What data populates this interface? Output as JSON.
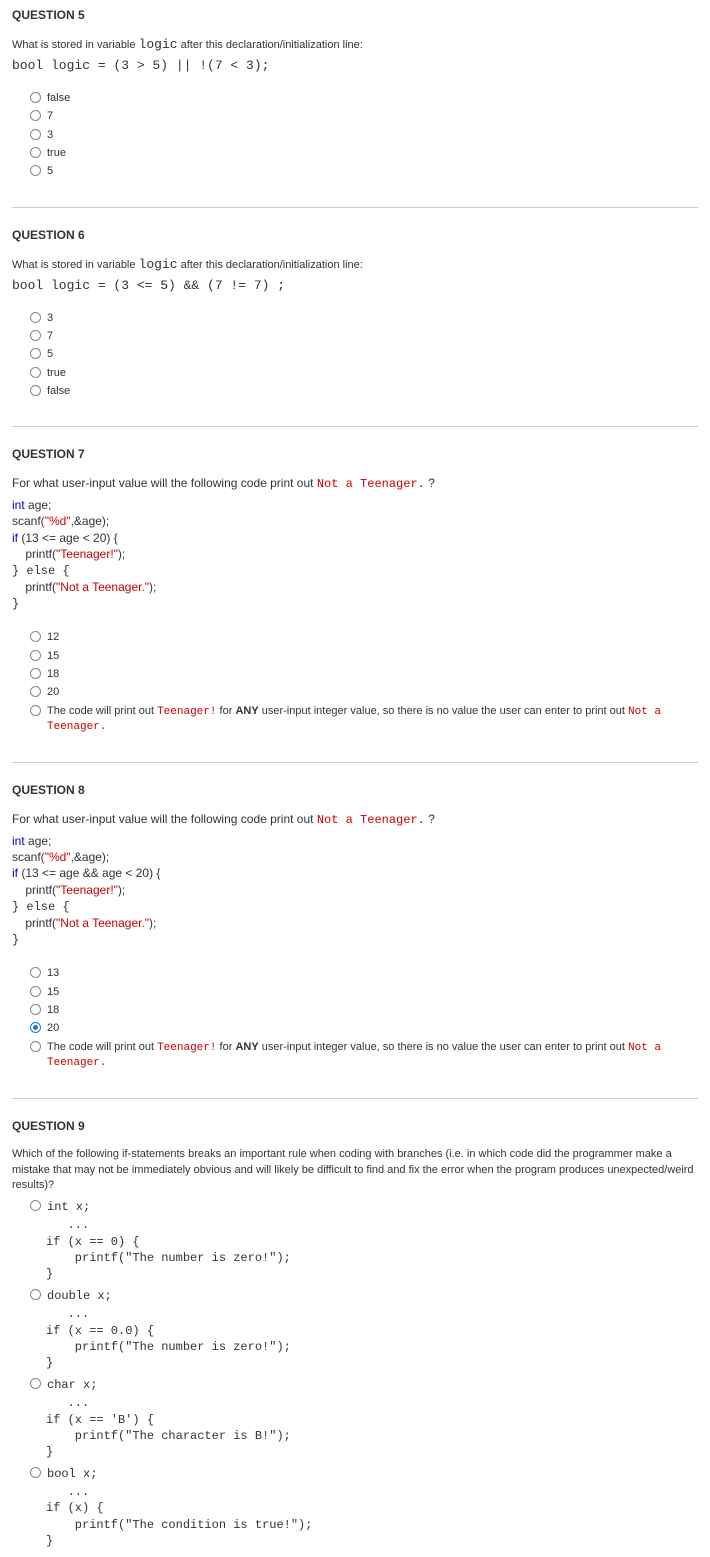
{
  "q5": {
    "title": "QUESTION 5",
    "prompt_a": "What is stored in variable ",
    "prompt_code": "logic",
    "prompt_b": " after this declaration/initialization line:",
    "code": "bool logic = (3 > 5) || !(7 < 3);",
    "opts": [
      "false",
      "7",
      "3",
      "true",
      "5"
    ]
  },
  "q6": {
    "title": "QUESTION 6",
    "prompt_a": "What is stored in variable ",
    "prompt_code": "logic",
    "prompt_b": " after this declaration/initialization line:",
    "code": "bool logic = (3 <= 5) && (7 != 7) ;",
    "opts": [
      "3",
      "7",
      "5",
      "true",
      "false"
    ]
  },
  "q7": {
    "title": "QUESTION 7",
    "prompt_a": "For what user-input value will the following code print out ",
    "prompt_code": "Not a Teenager.",
    "prompt_b": " ?",
    "code": {
      "l1a": "int",
      "l1b": " age;",
      "l2a": "scanf(",
      "l2b": "\"%d\"",
      "l2c": ",&age);",
      "l3a": "if",
      "l3b": " (13 <= age < 20) {",
      "l4a": "    printf(",
      "l4b": "\"Teenager!\"",
      "l4c": ");",
      "l5": "} else {",
      "l6a": "    printf(",
      "l6b": "\"Not a Teenager.\"",
      "l6c": ");",
      "l7": "}"
    },
    "opts": [
      "12",
      "15",
      "18",
      "20"
    ],
    "long_a": "The code will print out ",
    "long_code1": "Teenager!",
    "long_b": " for ",
    "long_bold": "ANY",
    "long_c": " user-input integer value, so there is no value the user can enter to print out ",
    "long_code2": "Not a Teenager."
  },
  "q8": {
    "title": "QUESTION 8",
    "prompt_a": "For what user-input value will the following code print out ",
    "prompt_code": "Not a Teenager.",
    "prompt_b": " ?",
    "code": {
      "l1a": "int",
      "l1b": " age;",
      "l2a": "scanf(",
      "l2b": "\"%d\"",
      "l2c": ",&age);",
      "l3a": "if",
      "l3b": " (13 <= age && age < 20) {",
      "l4a": "    printf(",
      "l4b": "\"Teenager!\"",
      "l4c": ");",
      "l5": "} else {",
      "l6a": "    printf(",
      "l6b": "\"Not a Teenager.\"",
      "l6c": ");",
      "l7": "}"
    },
    "opts": [
      "13",
      "15",
      "18",
      "20"
    ],
    "selected": 3,
    "long_a": "The code will print out ",
    "long_code1": "Teenager!",
    "long_b": " for ",
    "long_bold": "ANY",
    "long_c": " user-input integer value, so there is no value the user can enter to print out ",
    "long_code2": "Not a Teenager."
  },
  "q9": {
    "title": "QUESTION 9",
    "prompt": "Which of the following if-statements breaks an important rule when coding with branches  (i.e. in which code did the programmer make a mistake that may not be immediately obvious and will likely be difficult to find and fix the error when the program produces unexpected/weird results)?",
    "o1_head": "int x;",
    "o1_code": "   ...\nif (x == 0) {\n    printf(\"The number is zero!\");\n}",
    "o2_head": "double x;",
    "o2_code": "   ...\nif (x == 0.0) {\n    printf(\"The number is zero!\");\n}",
    "o3_head": "char x;",
    "o3_code": "   ...\nif (x == 'B') {\n    printf(\"The character is B!\");\n}",
    "o4_head": "bool x;",
    "o4_code": "   ...\nif (x) {\n    printf(\"The condition is true!\");\n}"
  }
}
